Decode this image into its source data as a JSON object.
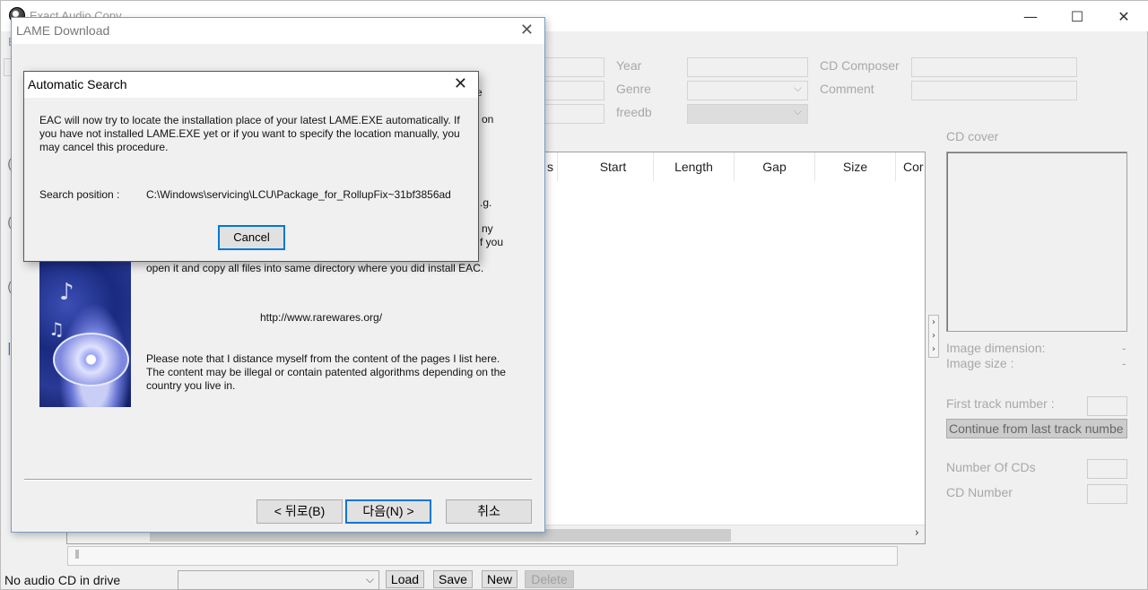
{
  "main_window": {
    "title": "Exact Audio Copy",
    "menu_first": "E",
    "fields": {
      "year_label": "Year",
      "genre_label": "Genre",
      "freedb_label": "freedb",
      "composer_label": "CD Composer",
      "comment_label": "Comment"
    },
    "track_columns": [
      "s",
      "Start",
      "Length",
      "Gap",
      "Size",
      "Cor"
    ],
    "cover": {
      "label": "CD cover",
      "image_dimension_label": "Image dimension:",
      "image_dimension_value": "-",
      "image_size_label": "Image size :",
      "image_size_value": "-"
    },
    "first_track_label": "First track number :",
    "continue_label": "Continue from last track numbe",
    "number_of_cds_label": "Number Of CDs",
    "cd_number_label": "CD Number",
    "status_bar": {
      "status_text": "No audio CD in drive",
      "load": "Load",
      "save": "Save",
      "new": "New",
      "delete": "Delete"
    }
  },
  "lame_dialog": {
    "title": "LAME Download",
    "peek_line1": "e",
    "peek_line2": "on",
    "peek_line3": ".g.",
    "peek_line4": "ny",
    "peek_line5": "f you",
    "instruction": "open it and copy all files into same directory where you did install EAC.",
    "url": "http://www.rarewares.org/",
    "disclaimer": "Please note that I distance myself from the content of the pages I list here. The content may be illegal or contain patented algorithms depending on the country you live in.",
    "back_button": "< 뒤로(B)",
    "next_button": "다음(N) >",
    "cancel_button": "취소"
  },
  "auto_search_dialog": {
    "title": "Automatic Search",
    "message": "EAC will now try to locate the installation place of your latest LAME.EXE automatically. If you have not installed LAME.EXE yet or if you want to specify the location manually, you may cancel this procedure.",
    "search_label": "Search position :",
    "search_value": "C:\\Windows\\servicing\\LCU\\Package_for_RollupFix~31bf3856ad",
    "cancel_button": "Cancel"
  }
}
